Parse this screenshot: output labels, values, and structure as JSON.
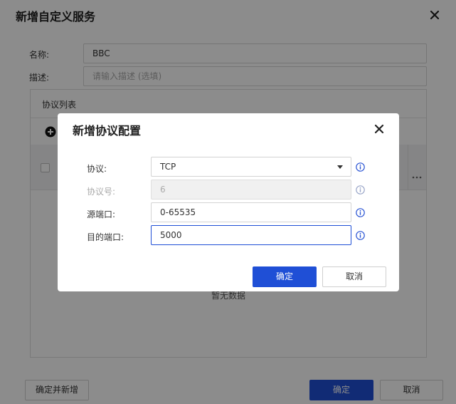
{
  "outer": {
    "title": "新增自定义服务",
    "name_label": "名称:",
    "name_value": "BBC",
    "desc_label": "描述:",
    "desc_placeholder": "请输入描述 (选填)",
    "protocol_list_title": "协议列表",
    "empty_text": "暂无数据",
    "more_icon": "more-icon",
    "confirm_and_add_label": "确定并新增",
    "confirm_label": "确定",
    "cancel_label": "取消"
  },
  "modal": {
    "title": "新增协议配置",
    "fields": [
      {
        "label": "协议:",
        "value": "TCP",
        "disabled": false,
        "focused": false,
        "is_select": true
      },
      {
        "label": "协议号:",
        "value": "6",
        "disabled": true,
        "focused": false,
        "is_select": false
      },
      {
        "label": "源端口:",
        "value": "0-65535",
        "disabled": false,
        "focused": false,
        "is_select": false
      },
      {
        "label": "目的端口:",
        "value": "5000",
        "disabled": false,
        "focused": true,
        "is_select": false
      }
    ],
    "confirm_label": "确定",
    "cancel_label": "取消"
  },
  "colors": {
    "primary": "#1f4fd6",
    "info_icon": "#2b55d4",
    "mask": "rgba(0,0,0,0.45)"
  }
}
